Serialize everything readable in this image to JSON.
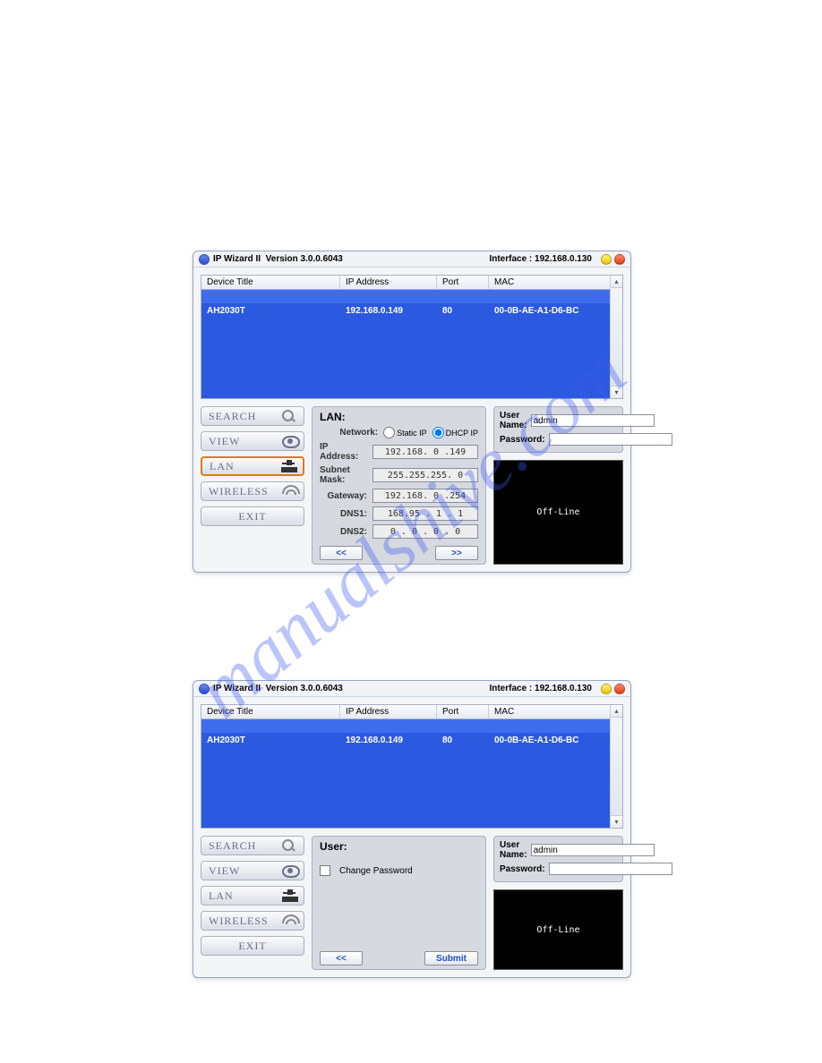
{
  "watermark_text": "manualshive.com",
  "titlebar": {
    "app": "IP Wizard II",
    "version_label": "Version 3.0.0.6043",
    "interface_label": "Interface : 192.168.0.130"
  },
  "table": {
    "headers": {
      "device": "Device Title",
      "ip": "IP Address",
      "port": "Port",
      "mac": "MAC"
    },
    "rows": [
      {
        "device": "",
        "ip": "",
        "port": "",
        "mac": ""
      },
      {
        "device": "AH2030T",
        "ip": "192.168.0.149",
        "port": "80",
        "mac": "00-0B-AE-A1-D6-BC"
      },
      {
        "device": "",
        "ip": "",
        "port": "",
        "mac": ""
      },
      {
        "device": "",
        "ip": "",
        "port": "",
        "mac": ""
      },
      {
        "device": "",
        "ip": "",
        "port": "",
        "mac": ""
      },
      {
        "device": "",
        "ip": "",
        "port": "",
        "mac": ""
      },
      {
        "device": "",
        "ip": "",
        "port": "",
        "mac": ""
      },
      {
        "device": "",
        "ip": "",
        "port": "",
        "mac": ""
      }
    ]
  },
  "sidebar": {
    "search": "SEARCH",
    "view": "VIEW",
    "lan": "LAN",
    "wireless": "WIRELESS",
    "exit": "EXIT"
  },
  "lan_panel": {
    "title": "LAN:",
    "network_label": "Network:",
    "static_label": "Static IP",
    "dhcp_label": "DHCP IP",
    "ip_label": "IP Address:",
    "ip_value": "192.168. 0 .149",
    "subnet_label": "Subnet Mask:",
    "subnet_value": "255.255.255. 0",
    "gateway_label": "Gateway:",
    "gateway_value": "192.168. 0 .254",
    "dns1_label": "DNS1:",
    "dns1_value": "168.95 . 1 . 1",
    "dns2_label": "DNS2:",
    "dns2_value": "0 . 0 . 0 . 0",
    "prev": "<<",
    "next": ">>"
  },
  "user_panel": {
    "title": "User:",
    "change_pw": "Change Password",
    "prev": "<<",
    "submit": "Submit"
  },
  "cred": {
    "user_label": "User Name:",
    "user_value": "admin",
    "pw_label": "Password:",
    "pw_value": ""
  },
  "preview": {
    "offline": "Off-Line"
  }
}
